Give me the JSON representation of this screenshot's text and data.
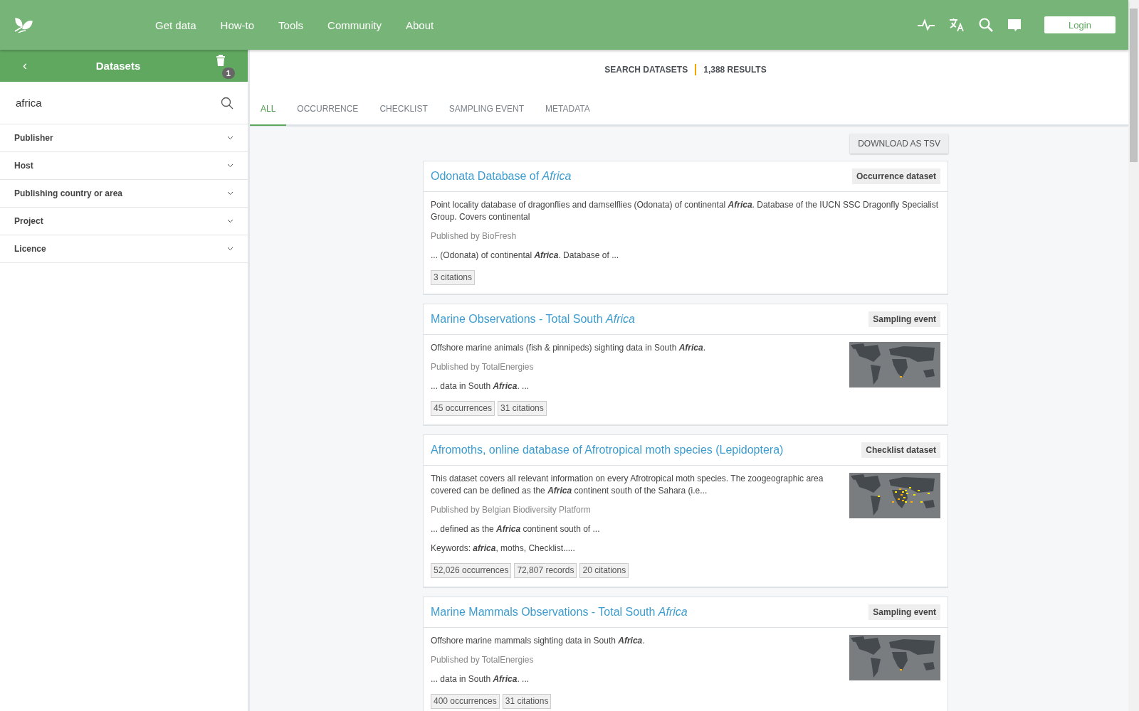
{
  "nav": {
    "items": [
      "Get data",
      "How-to",
      "Tools",
      "Community",
      "About"
    ],
    "login": "Login"
  },
  "sidebar": {
    "title": "Datasets",
    "back": "‹",
    "filter_count": "1",
    "search_value": "africa",
    "facets": [
      {
        "label": "Publisher",
        "expanded": false
      },
      {
        "label": "Host",
        "expanded": false
      },
      {
        "label": "Publishing country or area",
        "expanded": false
      },
      {
        "label": "Project",
        "expanded": false
      },
      {
        "label": "Licence",
        "expanded": false
      }
    ]
  },
  "results_header": {
    "label": "SEARCH DATASETS",
    "count": "1,388 RESULTS"
  },
  "tabs": [
    {
      "label": "ALL",
      "selected": true
    },
    {
      "label": "OCCURRENCE",
      "selected": false
    },
    {
      "label": "CHECKLIST",
      "selected": false
    },
    {
      "label": "SAMPLING EVENT",
      "selected": false
    },
    {
      "label": "METADATA",
      "selected": false
    }
  ],
  "download_button": "DOWNLOAD AS TSV",
  "results": [
    {
      "title": "Odonata Database of *Africa*",
      "type": "Occurrence dataset",
      "description": "Point locality database of dragonflies and damselflies (Odonata) of continental **Africa**. Database of the IUCN SSC Dragonfly Specialist Group. Covers continental",
      "publisher": "Published by BioFresh",
      "snippets": [
        "... (Odonata) of continental **Africa**. Database of ..."
      ],
      "counts": [
        "3 citations"
      ]
    },
    {
      "title": "Marine Observations - Total South *Africa*",
      "type": "Sampling event",
      "description": "Offshore marine animals (fish & pinnipeds) sighting data in South **Africa**.",
      "publisher": "Published by TotalEnergies",
      "snippets": [
        "... data in South **Africa**. ..."
      ],
      "counts": [
        "45 occurrences",
        "31 citations"
      ],
      "thumbnail": {
        "kind": "picture"
      }
    },
    {
      "title": "Afromoths, online database of Afrotropical moth species (Lepidoptera)",
      "type": "Checklist dataset",
      "description": "This dataset covers all relevant information on every Afrotropical moth species. The zoogeographic area covered can be defined as the **Africa** continent south of the Sahara (i.e...",
      "publisher": "Published by Belgian Biodiversity Platform",
      "snippets": [
        "... defined as the **Africa** continent south of ...",
        "Keywords: **africa**, moths, Checklist....."
      ],
      "counts": [
        "52,026 occurrences",
        "72,807 records",
        "20 citations"
      ],
      "thumbnail": {
        "kind": "picture"
      }
    },
    {
      "title": "Marine Mammals Observations - Total South *Africa*",
      "type": "Sampling event",
      "description": "Offshore marine mammals sighting data in South **Africa**.",
      "publisher": "Published by TotalEnergies",
      "snippets": [
        "... data in South **Africa**. ..."
      ],
      "counts": [
        "400 occurrences",
        "31 citations"
      ],
      "thumbnail": {
        "kind": "picture"
      }
    }
  ]
}
